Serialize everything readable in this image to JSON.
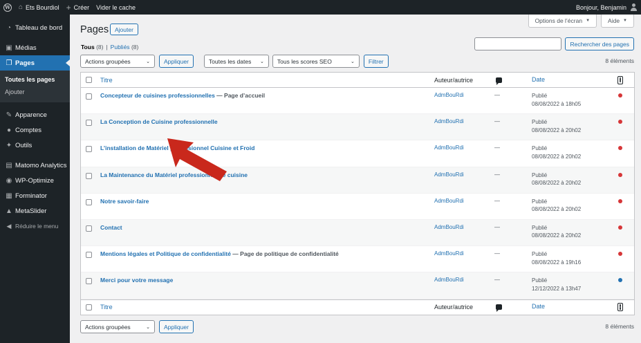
{
  "adminbar": {
    "site_name": "Ets Bourdiol",
    "new_label": "Créer",
    "cache_label": "Vider le cache",
    "greeting": "Bonjour, Benjamin"
  },
  "sidebar": {
    "items": [
      {
        "label": "Tableau de bord",
        "icon": "dashboard-icon"
      },
      {
        "label": "Médias",
        "icon": "media-icon"
      },
      {
        "label": "Pages",
        "icon": "pages-icon"
      },
      {
        "label": "Apparence",
        "icon": "appearance-icon"
      },
      {
        "label": "Comptes",
        "icon": "users-icon"
      },
      {
        "label": "Outils",
        "icon": "tools-icon"
      },
      {
        "label": "Matomo Analytics",
        "icon": "matomo-icon"
      },
      {
        "label": "WP-Optimize",
        "icon": "wp-optimize-icon"
      },
      {
        "label": "Forminator",
        "icon": "forminator-icon"
      },
      {
        "label": "MetaSlider",
        "icon": "metaslider-icon"
      }
    ],
    "submenu": [
      "Toutes les pages",
      "Ajouter"
    ],
    "collapse_label": "Réduire le menu"
  },
  "screen_options": {
    "options_label": "Options de l’écran",
    "help_label": "Aide"
  },
  "header": {
    "title": "Pages",
    "add_new": "Ajouter"
  },
  "views": {
    "all_label": "Tous",
    "all_count": "(8)",
    "separator": "|",
    "published_label": "Publiés",
    "published_count": "(8)"
  },
  "search": {
    "button": "Rechercher des pages",
    "value": ""
  },
  "tablenav": {
    "bulk_action": "Actions groupées",
    "apply": "Appliquer",
    "dates": "Toutes les dates",
    "seo": "Tous les scores SEO",
    "filter": "Filtrer",
    "items_count": "8 éléments"
  },
  "table": {
    "headers": {
      "title": "Titre",
      "author": "Auteur/autrice",
      "date": "Date"
    },
    "rows": [
      {
        "title": "Concepteur de cuisines professionnelles",
        "state": "— Page d’accueil",
        "author": "AdmBouRdi",
        "comments": "—",
        "status": "Publié",
        "date": "08/08/2022 à 18h05",
        "seo_color": "#d63638"
      },
      {
        "title": "La Conception de Cuisine professionnelle",
        "state": "",
        "author": "AdmBouRdi",
        "comments": "—",
        "status": "Publié",
        "date": "08/08/2022 à 20h02",
        "seo_color": "#d63638"
      },
      {
        "title": "L’installation de Matériel professionnel Cuisine et Froid",
        "state": "",
        "author": "AdmBouRdi",
        "comments": "—",
        "status": "Publié",
        "date": "08/08/2022 à 20h02",
        "seo_color": "#d63638"
      },
      {
        "title": "La Maintenance du Matériel professionnel de cuisine",
        "state": "",
        "author": "AdmBouRdi",
        "comments": "—",
        "status": "Publié",
        "date": "08/08/2022 à 20h02",
        "seo_color": "#d63638"
      },
      {
        "title": "Notre savoir-faire",
        "state": "",
        "author": "AdmBouRdi",
        "comments": "—",
        "status": "Publié",
        "date": "08/08/2022 à 20h02",
        "seo_color": "#d63638"
      },
      {
        "title": "Contact",
        "state": "",
        "author": "AdmBouRdi",
        "comments": "—",
        "status": "Publié",
        "date": "08/08/2022 à 20h02",
        "seo_color": "#d63638"
      },
      {
        "title": "Mentions légales et Politique de confidentialité",
        "state": "— Page de politique de confidentialité",
        "author": "AdmBouRdi",
        "comments": "—",
        "status": "Publié",
        "date": "08/08/2022 à 19h16",
        "seo_color": "#d63638"
      },
      {
        "title": "Merci pour votre message",
        "state": "",
        "author": "AdmBouRdi",
        "comments": "—",
        "status": "Publié",
        "date": "12/12/2022 à 13h47",
        "seo_color": "#2271b1"
      }
    ]
  },
  "annotation": {
    "arrow_color": "#c9281c"
  }
}
